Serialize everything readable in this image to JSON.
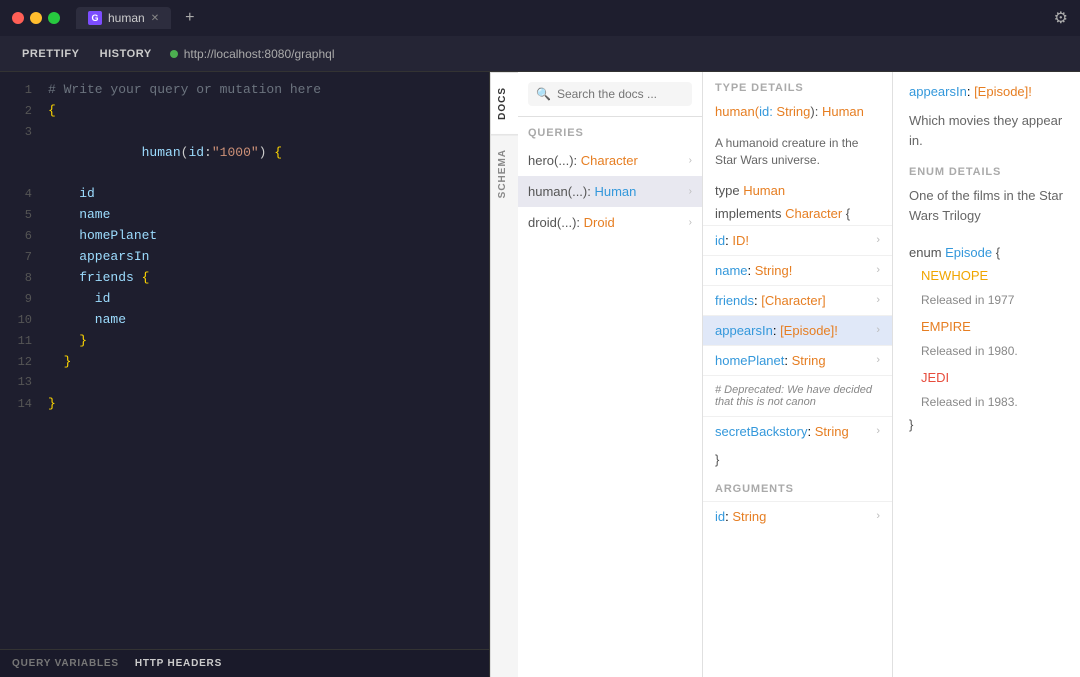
{
  "titlebar": {
    "tab_label": "human",
    "tab_icon": "G",
    "add_tab": "+",
    "gear": "⚙"
  },
  "toolbar": {
    "prettify": "PRETTIFY",
    "history": "HISTORY",
    "url": "http://localhost:8080/graphql"
  },
  "editor": {
    "comment": "# Write your query or mutation here",
    "lines": [
      {
        "num": "1",
        "content": "# Write your query or mutation here",
        "type": "comment"
      },
      {
        "num": "2",
        "content": "{",
        "type": "brace"
      },
      {
        "num": "3",
        "content": "  human(id:\"1000\") {",
        "type": "code"
      },
      {
        "num": "4",
        "content": "    id",
        "type": "field"
      },
      {
        "num": "5",
        "content": "    name",
        "type": "field"
      },
      {
        "num": "6",
        "content": "    homePlanet",
        "type": "field"
      },
      {
        "num": "7",
        "content": "    appearsIn",
        "type": "field"
      },
      {
        "num": "8",
        "content": "    friends {",
        "type": "field-brace"
      },
      {
        "num": "9",
        "content": "      id",
        "type": "field"
      },
      {
        "num": "10",
        "content": "      name",
        "type": "field"
      },
      {
        "num": "11",
        "content": "    }",
        "type": "brace"
      },
      {
        "num": "12",
        "content": "  }",
        "type": "brace"
      },
      {
        "num": "13",
        "content": "",
        "type": "empty"
      },
      {
        "num": "14",
        "content": "}",
        "type": "brace"
      }
    ]
  },
  "bottom_tabs": [
    {
      "label": "QUERY VARIABLES",
      "active": false
    },
    {
      "label": "HTTP HEADERS",
      "active": true
    }
  ],
  "vtabs": [
    {
      "label": "DOCS",
      "active": true
    },
    {
      "label": "SCHEMA",
      "active": false
    }
  ],
  "search": {
    "placeholder": "Search the docs ...",
    "queries_label": "QUERIES"
  },
  "queries": [
    {
      "name": "hero",
      "args": "(...): ",
      "type": "Character"
    },
    {
      "name": "human",
      "args": "(...): ",
      "type": "Human",
      "active": true
    },
    {
      "name": "droid",
      "args": "(...): ",
      "type": "Droid"
    }
  ],
  "type_details": {
    "header": "TYPE DETAILS",
    "title_func": "human(",
    "title_id": "id: ",
    "title_id_type": "String",
    "title_close": "): ",
    "title_return": "Human",
    "description": "A humanoid creature in the Star Wars universe.",
    "type_line": "type ",
    "type_name": "Human",
    "implements_kw": "implements ",
    "implements_name": "Character",
    "implements_brace": " {",
    "fields": [
      {
        "name": "id",
        "colon": ": ",
        "type": "ID!",
        "has_arrow": true,
        "selected": false
      },
      {
        "name": "name",
        "colon": ": ",
        "type": "String!",
        "has_arrow": true,
        "selected": false
      },
      {
        "name": "friends",
        "colon": ": ",
        "type": "[Character]",
        "has_arrow": true,
        "selected": false
      },
      {
        "name": "appearsIn",
        "colon": ": ",
        "type": "[Episode]!",
        "has_arrow": true,
        "selected": true
      },
      {
        "name": "homePlanet",
        "colon": ": ",
        "type": "String",
        "has_arrow": true,
        "selected": false
      }
    ],
    "deprecated_note": "# Deprecated: We have decided that this is not canon",
    "deprecated_field": "secretBackstory",
    "deprecated_colon": ": ",
    "deprecated_type": "String",
    "closing_brace": "}",
    "arguments_label": "ARGUMENTS",
    "arg_name": "id",
    "arg_colon": ": ",
    "arg_type": "String"
  },
  "right_panel": {
    "field_sig_name": "appearsIn",
    "field_sig_colon": ": ",
    "field_sig_type": "[Episode]!",
    "field_description": "Which movies they appear in.",
    "enum_header": "ENUM DETAILS",
    "enum_description": "One of the films in the Star Wars Trilogy",
    "enum_kw": "enum ",
    "enum_name": "Episode",
    "enum_brace_open": " {",
    "enum_brace_close": "}",
    "enum_values": [
      {
        "name": "NEWHOPE",
        "released": "Released in 1977",
        "color": "yellow"
      },
      {
        "name": "EMPIRE",
        "released": "Released in 1980.",
        "color": "orange"
      },
      {
        "name": "JEDI",
        "released": "Released in 1983.",
        "color": "red"
      }
    ]
  }
}
